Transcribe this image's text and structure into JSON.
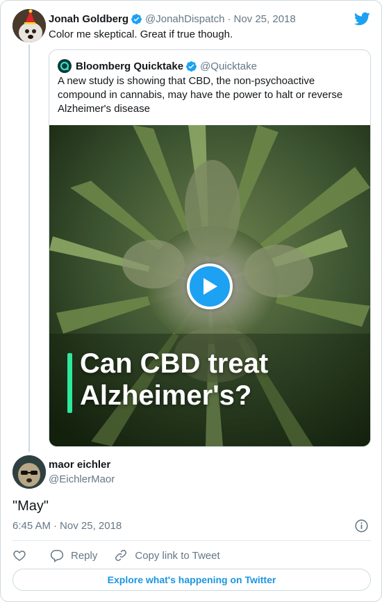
{
  "parent_tweet": {
    "display_name": "Jonah Goldberg",
    "handle": "@JonahDispatch",
    "separator": "·",
    "date": "Nov 25, 2018",
    "text": "Color me skeptical. Great if true though.",
    "avatar_icon": "avatar-party-hat-dog"
  },
  "quoted_tweet": {
    "display_name": "Bloomberg Quicktake",
    "handle": "@Quicktake",
    "text": "A new study is showing that CBD, the non-psychoactive compound in cannabis, may have the power to halt or reverse Alzheimer's disease",
    "media": {
      "overlay_line1": "Can CBD treat",
      "overlay_line2": "Alzheimer's?",
      "play_icon": "play-icon",
      "accent_color": "#2ee89b"
    }
  },
  "reply_tweet": {
    "display_name": "maor eichler",
    "handle": "@EichlerMaor",
    "text": "\"May\"",
    "time": "6:45 AM",
    "separator": "·",
    "date": "Nov 25, 2018"
  },
  "actions": {
    "like_icon": "heart-icon",
    "reply_label": "Reply",
    "copy_label": "Copy link to Tweet"
  },
  "footer": {
    "explore_label": "Explore what's happening on Twitter"
  },
  "colors": {
    "brand_blue": "#1da1f2",
    "link_blue": "#1b95e0",
    "secondary_text": "#657786",
    "border": "#cfd9de"
  }
}
